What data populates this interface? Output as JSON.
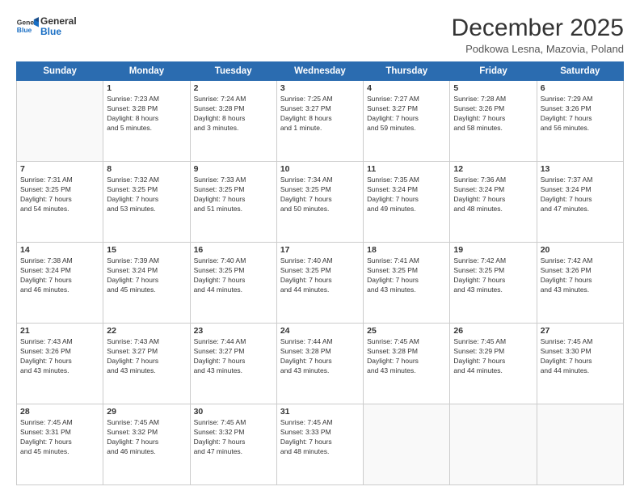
{
  "logo": {
    "line1": "General",
    "line2": "Blue"
  },
  "title": "December 2025",
  "subtitle": "Podkowa Lesna, Mazovia, Poland",
  "days_of_week": [
    "Sunday",
    "Monday",
    "Tuesday",
    "Wednesday",
    "Thursday",
    "Friday",
    "Saturday"
  ],
  "weeks": [
    [
      {
        "day": "",
        "info": ""
      },
      {
        "day": "1",
        "info": "Sunrise: 7:23 AM\nSunset: 3:28 PM\nDaylight: 8 hours\nand 5 minutes."
      },
      {
        "day": "2",
        "info": "Sunrise: 7:24 AM\nSunset: 3:28 PM\nDaylight: 8 hours\nand 3 minutes."
      },
      {
        "day": "3",
        "info": "Sunrise: 7:25 AM\nSunset: 3:27 PM\nDaylight: 8 hours\nand 1 minute."
      },
      {
        "day": "4",
        "info": "Sunrise: 7:27 AM\nSunset: 3:27 PM\nDaylight: 7 hours\nand 59 minutes."
      },
      {
        "day": "5",
        "info": "Sunrise: 7:28 AM\nSunset: 3:26 PM\nDaylight: 7 hours\nand 58 minutes."
      },
      {
        "day": "6",
        "info": "Sunrise: 7:29 AM\nSunset: 3:26 PM\nDaylight: 7 hours\nand 56 minutes."
      }
    ],
    [
      {
        "day": "7",
        "info": "Sunrise: 7:31 AM\nSunset: 3:25 PM\nDaylight: 7 hours\nand 54 minutes."
      },
      {
        "day": "8",
        "info": "Sunrise: 7:32 AM\nSunset: 3:25 PM\nDaylight: 7 hours\nand 53 minutes."
      },
      {
        "day": "9",
        "info": "Sunrise: 7:33 AM\nSunset: 3:25 PM\nDaylight: 7 hours\nand 51 minutes."
      },
      {
        "day": "10",
        "info": "Sunrise: 7:34 AM\nSunset: 3:25 PM\nDaylight: 7 hours\nand 50 minutes."
      },
      {
        "day": "11",
        "info": "Sunrise: 7:35 AM\nSunset: 3:24 PM\nDaylight: 7 hours\nand 49 minutes."
      },
      {
        "day": "12",
        "info": "Sunrise: 7:36 AM\nSunset: 3:24 PM\nDaylight: 7 hours\nand 48 minutes."
      },
      {
        "day": "13",
        "info": "Sunrise: 7:37 AM\nSunset: 3:24 PM\nDaylight: 7 hours\nand 47 minutes."
      }
    ],
    [
      {
        "day": "14",
        "info": "Sunrise: 7:38 AM\nSunset: 3:24 PM\nDaylight: 7 hours\nand 46 minutes."
      },
      {
        "day": "15",
        "info": "Sunrise: 7:39 AM\nSunset: 3:24 PM\nDaylight: 7 hours\nand 45 minutes."
      },
      {
        "day": "16",
        "info": "Sunrise: 7:40 AM\nSunset: 3:25 PM\nDaylight: 7 hours\nand 44 minutes."
      },
      {
        "day": "17",
        "info": "Sunrise: 7:40 AM\nSunset: 3:25 PM\nDaylight: 7 hours\nand 44 minutes."
      },
      {
        "day": "18",
        "info": "Sunrise: 7:41 AM\nSunset: 3:25 PM\nDaylight: 7 hours\nand 43 minutes."
      },
      {
        "day": "19",
        "info": "Sunrise: 7:42 AM\nSunset: 3:25 PM\nDaylight: 7 hours\nand 43 minutes."
      },
      {
        "day": "20",
        "info": "Sunrise: 7:42 AM\nSunset: 3:26 PM\nDaylight: 7 hours\nand 43 minutes."
      }
    ],
    [
      {
        "day": "21",
        "info": "Sunrise: 7:43 AM\nSunset: 3:26 PM\nDaylight: 7 hours\nand 43 minutes."
      },
      {
        "day": "22",
        "info": "Sunrise: 7:43 AM\nSunset: 3:27 PM\nDaylight: 7 hours\nand 43 minutes."
      },
      {
        "day": "23",
        "info": "Sunrise: 7:44 AM\nSunset: 3:27 PM\nDaylight: 7 hours\nand 43 minutes."
      },
      {
        "day": "24",
        "info": "Sunrise: 7:44 AM\nSunset: 3:28 PM\nDaylight: 7 hours\nand 43 minutes."
      },
      {
        "day": "25",
        "info": "Sunrise: 7:45 AM\nSunset: 3:28 PM\nDaylight: 7 hours\nand 43 minutes."
      },
      {
        "day": "26",
        "info": "Sunrise: 7:45 AM\nSunset: 3:29 PM\nDaylight: 7 hours\nand 44 minutes."
      },
      {
        "day": "27",
        "info": "Sunrise: 7:45 AM\nSunset: 3:30 PM\nDaylight: 7 hours\nand 44 minutes."
      }
    ],
    [
      {
        "day": "28",
        "info": "Sunrise: 7:45 AM\nSunset: 3:31 PM\nDaylight: 7 hours\nand 45 minutes."
      },
      {
        "day": "29",
        "info": "Sunrise: 7:45 AM\nSunset: 3:32 PM\nDaylight: 7 hours\nand 46 minutes."
      },
      {
        "day": "30",
        "info": "Sunrise: 7:45 AM\nSunset: 3:32 PM\nDaylight: 7 hours\nand 47 minutes."
      },
      {
        "day": "31",
        "info": "Sunrise: 7:45 AM\nSunset: 3:33 PM\nDaylight: 7 hours\nand 48 minutes."
      },
      {
        "day": "",
        "info": ""
      },
      {
        "day": "",
        "info": ""
      },
      {
        "day": "",
        "info": ""
      }
    ]
  ]
}
